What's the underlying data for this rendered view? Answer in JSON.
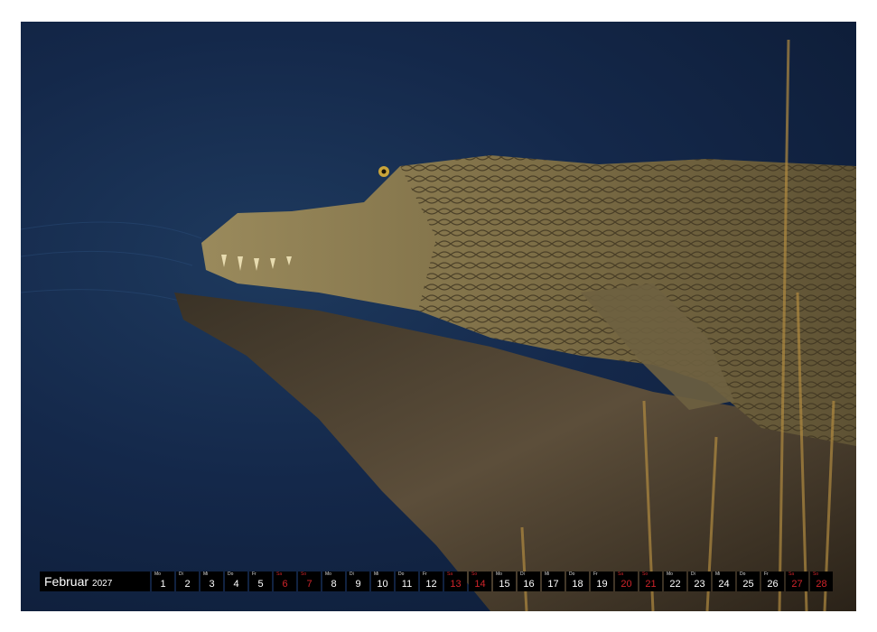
{
  "calendar": {
    "month": "Februar",
    "year": "2027",
    "days": [
      {
        "wd": "Mo",
        "d": "1",
        "weekend": false
      },
      {
        "wd": "Di",
        "d": "2",
        "weekend": false
      },
      {
        "wd": "Mi",
        "d": "3",
        "weekend": false
      },
      {
        "wd": "Do",
        "d": "4",
        "weekend": false
      },
      {
        "wd": "Fr",
        "d": "5",
        "weekend": false
      },
      {
        "wd": "Sa",
        "d": "6",
        "weekend": true
      },
      {
        "wd": "So",
        "d": "7",
        "weekend": true
      },
      {
        "wd": "Mo",
        "d": "8",
        "weekend": false
      },
      {
        "wd": "Di",
        "d": "9",
        "weekend": false
      },
      {
        "wd": "Mi",
        "d": "10",
        "weekend": false
      },
      {
        "wd": "Do",
        "d": "11",
        "weekend": false
      },
      {
        "wd": "Fr",
        "d": "12",
        "weekend": false
      },
      {
        "wd": "Sa",
        "d": "13",
        "weekend": true
      },
      {
        "wd": "So",
        "d": "14",
        "weekend": true
      },
      {
        "wd": "Mo",
        "d": "15",
        "weekend": false
      },
      {
        "wd": "Di",
        "d": "16",
        "weekend": false
      },
      {
        "wd": "Mi",
        "d": "17",
        "weekend": false
      },
      {
        "wd": "Do",
        "d": "18",
        "weekend": false
      },
      {
        "wd": "Fr",
        "d": "19",
        "weekend": false
      },
      {
        "wd": "Sa",
        "d": "20",
        "weekend": true
      },
      {
        "wd": "So",
        "d": "21",
        "weekend": true
      },
      {
        "wd": "Mo",
        "d": "22",
        "weekend": false
      },
      {
        "wd": "Di",
        "d": "23",
        "weekend": false
      },
      {
        "wd": "Mi",
        "d": "24",
        "weekend": false
      },
      {
        "wd": "Do",
        "d": "25",
        "weekend": false
      },
      {
        "wd": "Fr",
        "d": "26",
        "weekend": false
      },
      {
        "wd": "Sa",
        "d": "27",
        "weekend": true
      },
      {
        "wd": "So",
        "d": "28",
        "weekend": true
      }
    ]
  },
  "colors": {
    "water": "#14284a",
    "crocodile": "#8a7a4e",
    "weekend": "#d0242a",
    "bar": "#000000"
  }
}
